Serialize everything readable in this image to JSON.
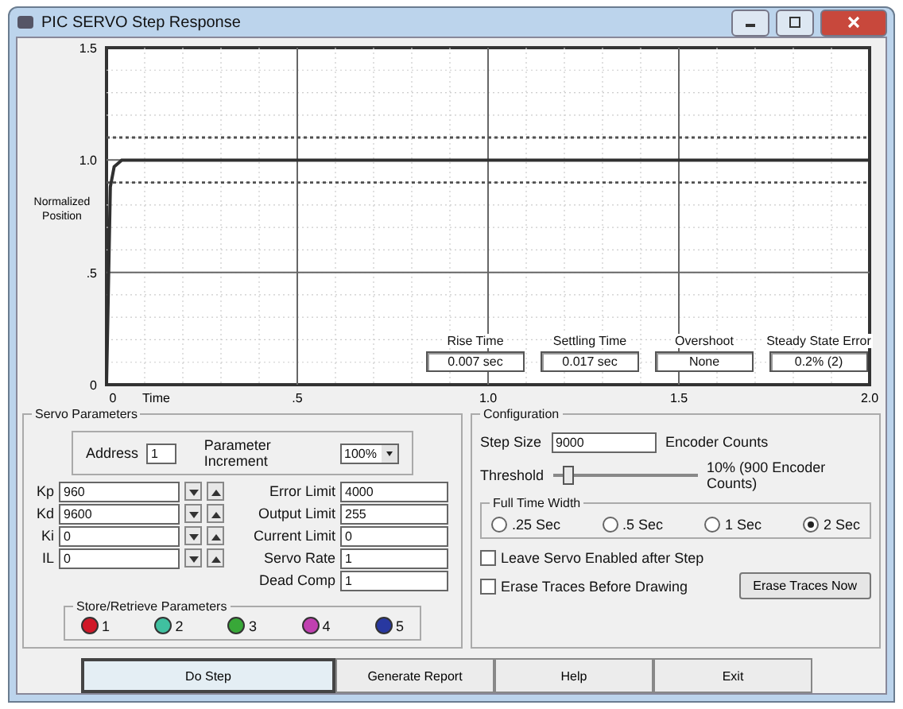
{
  "window": {
    "title": "PIC SERVO Step Response"
  },
  "plot": {
    "chart_data": {
      "type": "line",
      "xlabel": "Time",
      "ylabel": "Normalized Position",
      "xlim": [
        0,
        2
      ],
      "ylim": [
        0,
        1.5
      ],
      "xticks": [
        {
          "value": 0,
          "label": "0"
        },
        {
          "value": 0.5,
          "label": ".5"
        },
        {
          "value": 1,
          "label": "1.0"
        },
        {
          "value": 1.5,
          "label": "1.5"
        },
        {
          "value": 2,
          "label": "2.0"
        }
      ],
      "yticks": [
        {
          "value": 0,
          "label": "0"
        },
        {
          "value": 0.5,
          "label": ".5"
        },
        {
          "value": 1,
          "label": "1.0"
        },
        {
          "value": 1.5,
          "label": "1.5"
        }
      ],
      "x": [
        0,
        0.01,
        0.02,
        0.04,
        2.0
      ],
      "series": [
        {
          "color": "#303030",
          "line_style": "solid",
          "values": [
            0,
            0.88,
            0.97,
            1.0,
            1.0
          ]
        },
        {
          "color": "#505050",
          "line_style": "dashed",
          "values": [
            1.1,
            1.1,
            1.1,
            1.1,
            1.1
          ]
        },
        {
          "color": "#505050",
          "line_style": "dashed",
          "values": [
            0.9,
            0.9,
            0.9,
            0.9,
            0.9
          ]
        }
      ],
      "grid": true
    },
    "readouts": [
      {
        "label": "Rise Time",
        "value": "0.007 sec"
      },
      {
        "label": "Settling Time",
        "value": "0.017 sec"
      },
      {
        "label": "Overshoot",
        "value": "None"
      },
      {
        "label": "Steady State Error",
        "value": "0.2% (2)"
      }
    ]
  },
  "servo_parameters": {
    "title": "Servo Parameters",
    "address": {
      "label": "Address",
      "value": "1"
    },
    "increment": {
      "label": "Parameter Increment",
      "value": "100%"
    },
    "gains": [
      {
        "label": "Kp",
        "value": "960"
      },
      {
        "label": "Kd",
        "value": "9600"
      },
      {
        "label": "Ki",
        "value": "0"
      },
      {
        "label": "IL",
        "value": "0"
      }
    ],
    "limits": [
      {
        "label": "Error Limit",
        "value": "4000"
      },
      {
        "label": "Output Limit",
        "value": "255"
      },
      {
        "label": "Current Limit",
        "value": "0"
      },
      {
        "label": "Servo Rate",
        "value": "1"
      },
      {
        "label": "Dead Comp",
        "value": "1"
      }
    ],
    "store": {
      "title": "Store/Retrieve Parameters",
      "slots": [
        {
          "label": "1",
          "color": "#d01828"
        },
        {
          "label": "2",
          "color": "#40c0a0"
        },
        {
          "label": "3",
          "color": "#38a838"
        },
        {
          "label": "4",
          "color": "#c040b0"
        },
        {
          "label": "5",
          "color": "#2838a0"
        }
      ]
    }
  },
  "configuration": {
    "title": "Configuration",
    "step_size": {
      "label": "Step Size",
      "value": "9000",
      "unit": "Encoder Counts"
    },
    "threshold": {
      "label": "Threshold",
      "level": 0.1,
      "reading": "10% (900 Encoder Counts)"
    },
    "time_width": {
      "title": "Full Time Width",
      "options": [
        {
          "label": ".25 Sec",
          "selected": false
        },
        {
          "label": ".5 Sec",
          "selected": false
        },
        {
          "label": "1 Sec",
          "selected": false
        },
        {
          "label": "2 Sec",
          "selected": true
        }
      ]
    },
    "checks": [
      {
        "label": "Leave Servo Enabled after Step",
        "checked": false
      },
      {
        "label": "Erase Traces Before Drawing",
        "checked": false
      }
    ],
    "erase_button": "Erase Traces Now"
  },
  "buttons": [
    {
      "label": "Do Step",
      "default": true
    },
    {
      "label": "Generate Report",
      "default": false
    },
    {
      "label": "Help",
      "default": false
    },
    {
      "label": "Exit",
      "default": false
    }
  ]
}
